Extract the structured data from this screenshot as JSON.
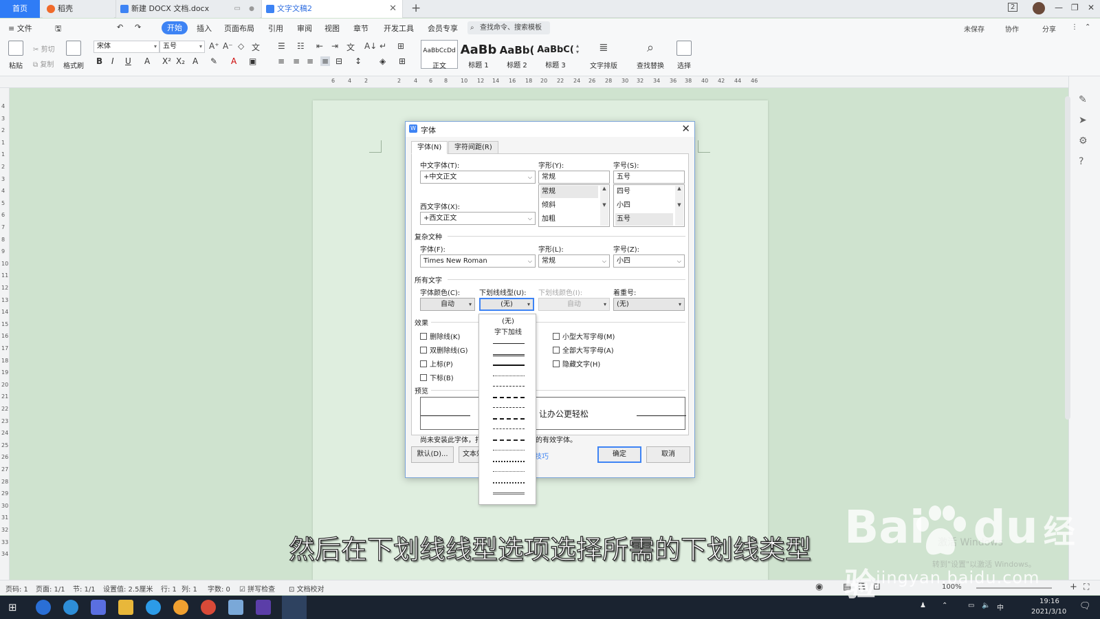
{
  "tabs": {
    "home": "首页",
    "daoke": "稻壳",
    "docx": "新建 DOCX 文档.docx",
    "doc2": "文字文稿2",
    "add": "+"
  },
  "window": {
    "badge": "2",
    "min": "—",
    "max": "❐",
    "close": "✕"
  },
  "menu": {
    "file": "≡ 文件",
    "items": [
      "开始",
      "插入",
      "页面布局",
      "引用",
      "审阅",
      "视图",
      "章节",
      "开发工具",
      "会员专享"
    ],
    "search": "查找命令、搜索模板",
    "right": [
      "未保存",
      "协作",
      "分享"
    ]
  },
  "ribbon": {
    "paste": "粘贴",
    "cut": "剪切",
    "copy": "复制",
    "format_painter": "格式刷",
    "font_name": "宋体",
    "font_size": "五号",
    "styles": [
      {
        "sample": "AaBbCcDd",
        "name": "正文"
      },
      {
        "sample": "AaBb",
        "name": "标题 1"
      },
      {
        "sample": "AaBb(",
        "name": "标题 2"
      },
      {
        "sample": "AaBbC(",
        "name": "标题 3"
      }
    ],
    "text_layout": "文字排版",
    "find_replace": "查找替换",
    "select": "选择"
  },
  "ruler": {
    "h": [
      "6",
      "4",
      "2",
      "2",
      "4",
      "6",
      "8",
      "10",
      "12",
      "14",
      "16",
      "18",
      "20",
      "22",
      "24",
      "26",
      "28",
      "30",
      "32",
      "34",
      "36",
      "38",
      "40",
      "42",
      "44",
      "46"
    ],
    "v": [
      "4",
      "3",
      "2",
      "1",
      "1",
      "2",
      "3",
      "4",
      "5",
      "6",
      "7",
      "8",
      "9",
      "10",
      "11",
      "12",
      "13",
      "14",
      "15",
      "16",
      "17",
      "18",
      "19",
      "20",
      "21",
      "22",
      "23",
      "24",
      "25",
      "26",
      "27",
      "28",
      "29",
      "30",
      "31",
      "32",
      "33",
      "34"
    ]
  },
  "dialog": {
    "title": "字体",
    "tabs": {
      "font": "字体(N)",
      "spacing": "字符间距(R)"
    },
    "cn_font_label": "中文字体(T):",
    "cn_font_value": "+中文正文",
    "style_label": "字形(Y):",
    "style_value": "常规",
    "style_list": [
      "常规",
      "倾斜",
      "加粗"
    ],
    "size_label": "字号(S):",
    "size_value": "五号",
    "size_list": [
      "四号",
      "小四",
      "五号"
    ],
    "west_font_label": "西文字体(X):",
    "west_font_value": "+西文正文",
    "complex_section": "复杂文种",
    "cx_font_label": "字体(F):",
    "cx_font_value": "Times New Roman",
    "cx_style_label": "字形(L):",
    "cx_style_value": "常规",
    "cx_size_label": "字号(Z):",
    "cx_size_value": "小四",
    "all_text_section": "所有文字",
    "color_label": "字体颜色(C):",
    "color_value": "自动",
    "uline_label": "下划线线型(U):",
    "uline_value": "(无)",
    "ucolor_label": "下划线颜色(I):",
    "ucolor_value": "自动",
    "emph_label": "着重号:",
    "emph_value": "(无)",
    "effects_section": "效果",
    "effects_left": [
      "删除线(K)",
      "双删除线(G)",
      "上标(P)",
      "下标(B)"
    ],
    "effects_right": [
      "小型大写字母(M)",
      "全部大写字母(A)",
      "隐藏文字(H)"
    ],
    "preview_section": "预览",
    "preview_text": "让办公更轻松",
    "note_left": "尚未安装此字体，打",
    "note_right": "的有效字体。",
    "btn_default": "默认(D)...",
    "btn_text_effects": "文本效",
    "tips_link": "技巧",
    "btn_ok": "确定",
    "btn_cancel": "取消"
  },
  "underline_dropdown": {
    "options": [
      "(无)",
      "字下加线"
    ],
    "line_styles": [
      "single",
      "double",
      "thick",
      "dotted",
      "dashed",
      "dashed-heavy",
      "long-dash",
      "long-dash-heavy",
      "dot-dash",
      "dot-dash-heavy",
      "dot-dot-dash",
      "dot-dot-dash-heavy",
      "wave",
      "wave-heavy",
      "double-wave"
    ]
  },
  "statusbar": {
    "items": [
      "页码: 1",
      "页面: 1/1",
      "节: 1/1",
      "设置值: 2.5厘米",
      "行: 1",
      "列: 1",
      "字数: 0",
      "拼写检查",
      "文档校对"
    ],
    "zoom": "100%"
  },
  "taskbar": {
    "time": "19:16",
    "date": "2021/3/10",
    "ime": "中"
  },
  "subtitle": "然后在下划线线型选项选择所需的下划线类型",
  "watermark": {
    "logo": "Bai",
    "logo2": "du",
    "jingyan": "经验",
    "url": "jingyan.baidu.com",
    "activate": "激活 Windows",
    "activate_sub": "转到\"设置\"以激活 Windows。"
  }
}
